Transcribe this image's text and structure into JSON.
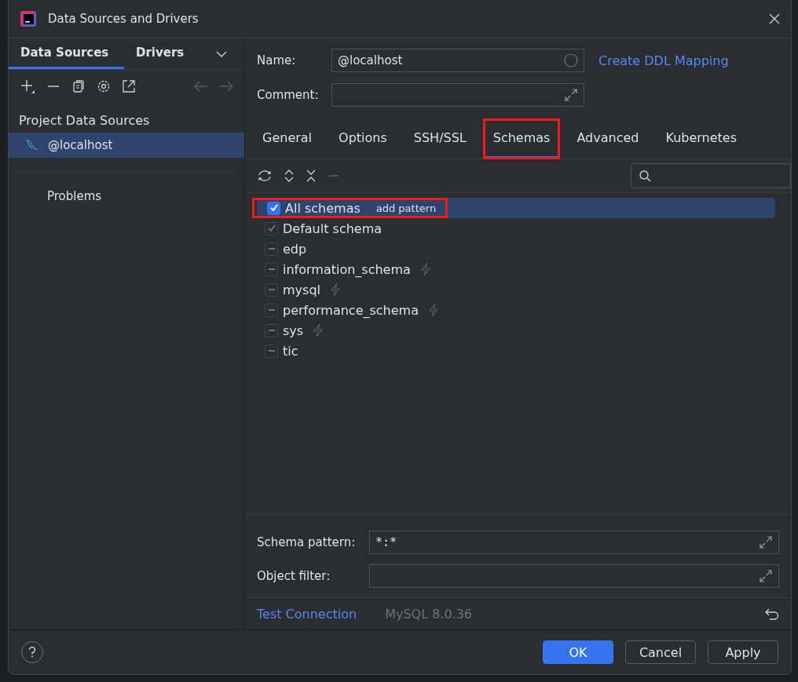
{
  "window": {
    "title": "Data Sources and Drivers"
  },
  "left_tabs": [
    {
      "label": "Data Sources",
      "selected": true
    },
    {
      "label": "Drivers",
      "selected": false
    }
  ],
  "sidebar": {
    "heading": "Project Data Sources",
    "items": [
      {
        "label": "@localhost",
        "selected": true
      }
    ],
    "problems": "Problems"
  },
  "form": {
    "name_label": "Name:",
    "name_value": "@localhost",
    "link": "Create DDL Mapping",
    "comment_label": "Comment:"
  },
  "tabs": [
    {
      "label": "General",
      "selected": false,
      "highlighted": false
    },
    {
      "label": "Options",
      "selected": false,
      "highlighted": false
    },
    {
      "label": "SSH/SSL",
      "selected": false,
      "highlighted": false
    },
    {
      "label": "Schemas",
      "selected": true,
      "highlighted": true
    },
    {
      "label": "Advanced",
      "selected": false,
      "highlighted": false
    },
    {
      "label": "Kubernetes",
      "selected": false,
      "highlighted": false
    }
  ],
  "schemas": [
    {
      "label": "All schemas",
      "hint": "add pattern",
      "kind": "checked",
      "selected": true,
      "highlighted": true,
      "lightning": false
    },
    {
      "label": "Default schema",
      "kind": "default",
      "selected": false,
      "highlighted": false,
      "lightning": false
    },
    {
      "label": "edp",
      "kind": "excluded",
      "selected": false,
      "highlighted": false,
      "lightning": false
    },
    {
      "label": "information_schema",
      "kind": "excluded",
      "selected": false,
      "highlighted": false,
      "lightning": true
    },
    {
      "label": "mysql",
      "kind": "excluded",
      "selected": false,
      "highlighted": false,
      "lightning": true
    },
    {
      "label": "performance_schema",
      "kind": "excluded",
      "selected": false,
      "highlighted": false,
      "lightning": true
    },
    {
      "label": "sys",
      "kind": "excluded",
      "selected": false,
      "highlighted": false,
      "lightning": true
    },
    {
      "label": "tic",
      "kind": "excluded",
      "selected": false,
      "highlighted": false,
      "lightning": false
    }
  ],
  "filters": [
    {
      "label": "Schema pattern:",
      "value": "*:*"
    },
    {
      "label": "Object filter:"
    }
  ],
  "status": {
    "link": "Test Connection",
    "version": "MySQL 8.0.36"
  },
  "buttons": [
    {
      "label": "OK",
      "kind": "primary"
    },
    {
      "label": "Cancel",
      "kind": "normal"
    },
    {
      "label": "Apply",
      "kind": "normal"
    }
  ]
}
